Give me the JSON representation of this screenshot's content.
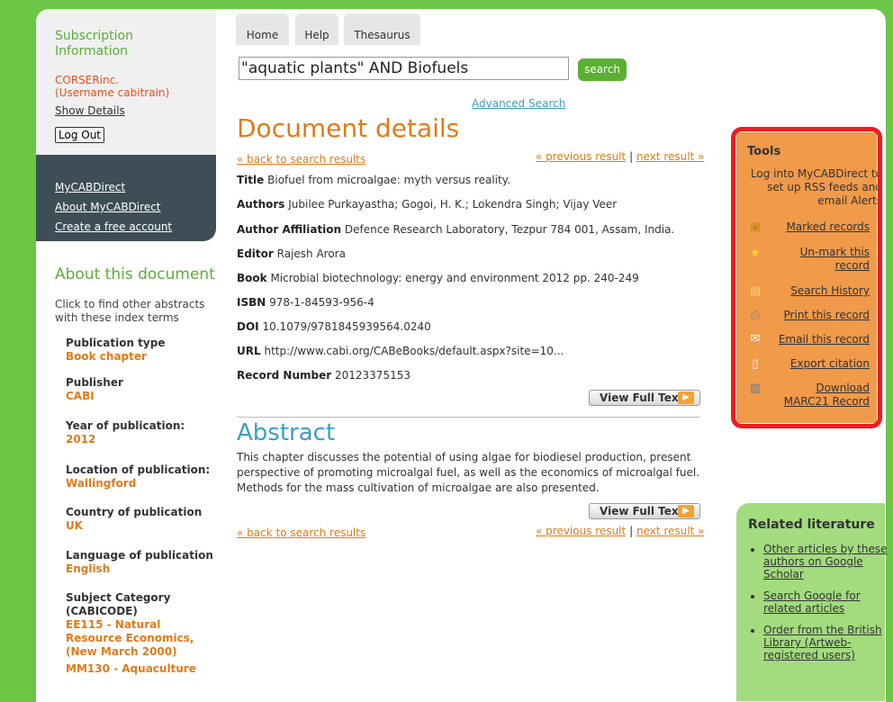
{
  "subscription": {
    "title": "Subscription Information",
    "company": "CORSERinc.",
    "username_prefix": "(Username ",
    "username": "cabitrain",
    "username_suffix": ")",
    "show_details": "Show Details",
    "logout": "Log Out"
  },
  "mycab": {
    "links": [
      "MyCABDirect",
      "About MyCABDirect",
      "Create a free account"
    ]
  },
  "about": {
    "title": "About this document",
    "description": "Click to find other abstracts with these index terms",
    "terms": [
      {
        "label": "Publication type",
        "value": "Book chapter"
      },
      {
        "label": "Publisher",
        "value": "CABI"
      },
      {
        "label": "Year of publication:",
        "value": "2012"
      },
      {
        "label": "Location of publication:",
        "value": "Wallingford"
      },
      {
        "label": "Country of publication",
        "value": "UK"
      },
      {
        "label": "Language of publication",
        "value": "English"
      },
      {
        "label": "Subject Category (CABICODE)",
        "value": "EE115 - Natural Resource Economics, (New March 2000)"
      },
      {
        "label": "",
        "value": "MM130 - Aquaculture"
      }
    ]
  },
  "nav": {
    "tabs": [
      "Home",
      "Help",
      "Thesaurus"
    ],
    "search_query": "\"aquatic plants\" AND Biofuels",
    "search_button": "search",
    "advanced": "Advanced Search"
  },
  "document": {
    "title": "Document details",
    "back": "« back to search results",
    "previous": "« previous result",
    "separator": "|",
    "next": "next result »",
    "fields": [
      {
        "label": "Title",
        "value": "Biofuel from microalgae: myth versus reality."
      },
      {
        "label": "Authors",
        "value": "Jubilee Purkayastha; Gogoi, H. K.; Lokendra Singh; Vijay Veer"
      },
      {
        "label": "Author Affiliation",
        "value": "Defence Research Laboratory, Tezpur 784 001, Assam, India."
      },
      {
        "label": "Editor",
        "value": "Rajesh Arora"
      },
      {
        "label": "Book",
        "value": "Microbial biotechnology: energy and environment 2012 pp. 240-249"
      },
      {
        "label": "ISBN",
        "value": "978-1-84593-956-4"
      },
      {
        "label": "DOI",
        "value": "10.1079/9781845939564.0240"
      },
      {
        "label": "URL",
        "value": "http://www.cabi.org/CABeBooks/default.aspx?site=10..."
      },
      {
        "label": "Record Number",
        "value": "20123375153"
      }
    ],
    "view_full_text": "View Full Text"
  },
  "abstract": {
    "title": "Abstract",
    "text": "This chapter discusses the potential of using algae for biodiesel production, present perspective of promoting microalgal fuel, as well as the economics of microalgal fuel. Methods for the mass cultivation of microalgae are also presented."
  },
  "tools": {
    "title": "Tools",
    "message": "Log into MyCABDirect to set up RSS feeds and email Alerts",
    "items": [
      {
        "label": "Marked records",
        "icon": "marked-records-icon"
      },
      {
        "label": "Un-mark this record",
        "icon": "star-icon"
      },
      {
        "label": "Search History",
        "icon": "search-history-icon"
      },
      {
        "label": "Print this record",
        "icon": "printer-icon"
      },
      {
        "label": "Email this record",
        "icon": "envelope-icon"
      },
      {
        "label": "Export citation",
        "icon": "export-icon"
      },
      {
        "label": "Download MARC21 Record",
        "icon": "book-icon"
      }
    ]
  },
  "related": {
    "title": "Related literature",
    "items": [
      "Other articles by these authors on Google Scholar",
      "Search Google for related articles",
      "Order from the British Library (Artweb-registered users)"
    ]
  },
  "colors": {
    "brand_green": "#6cc645",
    "accent_orange": "#e07b1a",
    "abstract_blue": "#3a9ec4",
    "tools_bg": "#f09a4a",
    "highlight_red": "#ee1b24"
  }
}
